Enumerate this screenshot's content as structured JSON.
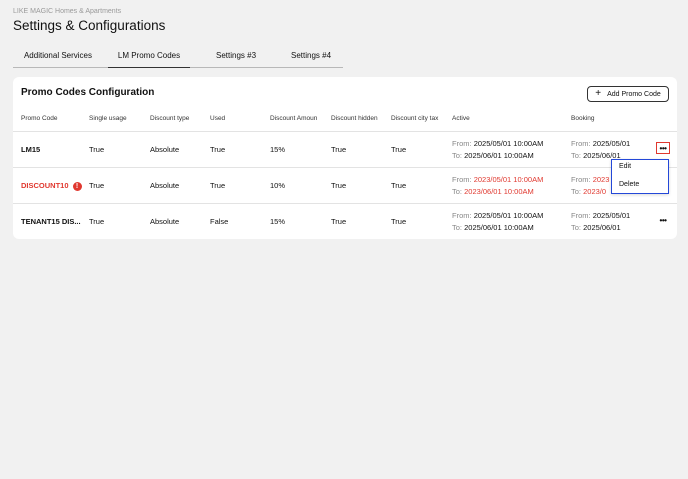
{
  "breadcrumb": "LIKE MAGIC Homes & Apartments",
  "page_title": "Settings & Configurations",
  "tabs": [
    {
      "label": "Additional Services",
      "active": false
    },
    {
      "label": "LM Promo Codes",
      "active": true
    },
    {
      "label": "Settings #3",
      "active": false
    },
    {
      "label": "Settings #4",
      "active": false
    }
  ],
  "card": {
    "title": "Promo Codes Configuration",
    "add_button_label": "Add Promo Code",
    "add_button_icon": "plus-icon"
  },
  "columns": [
    "Promo Code",
    "Single usage",
    "Discount type",
    "Used",
    "Discount Amoun",
    "Discount hidden",
    "Discount city tax",
    "Active",
    "Booking"
  ],
  "date_labels": {
    "from": "From:",
    "to": "To:"
  },
  "rows": [
    {
      "code": "LM15",
      "expired": false,
      "single_usage": "True",
      "discount_type": "Absolute",
      "used": "True",
      "amount": "15%",
      "hidden": "True",
      "city_tax": "True",
      "active_from": "2025/05/01 10:00AM",
      "active_to": "2025/06/01 10:00AM",
      "booking_from": "2025/05/01",
      "booking_to": "2025/06/01"
    },
    {
      "code": "DISCOUNT10",
      "expired": true,
      "single_usage": "True",
      "discount_type": "Absolute",
      "used": "True",
      "amount": "10%",
      "hidden": "True",
      "city_tax": "True",
      "active_from": "2023/05/01 10:00AM",
      "active_to": "2023/06/01 10:00AM",
      "booking_from": "2023",
      "booking_to": "2023/0"
    },
    {
      "code": "TENANT15 DIS...",
      "expired": false,
      "single_usage": "True",
      "discount_type": "Absolute",
      "used": "False",
      "amount": "15%",
      "hidden": "True",
      "city_tax": "True",
      "active_from": "2025/05/01 10:00AM",
      "active_to": "2025/06/01 10:00AM",
      "booking_from": "2025/05/01",
      "booking_to": "2025/06/01"
    }
  ],
  "more_icon_text": "•••",
  "alert_icon_text": "!",
  "context_menu": {
    "items": [
      "Edit",
      "Delete"
    ]
  },
  "colors": {
    "expired_red": "#e0382f",
    "menu_border": "#2448d8",
    "highlight_border": "#e0382f"
  }
}
